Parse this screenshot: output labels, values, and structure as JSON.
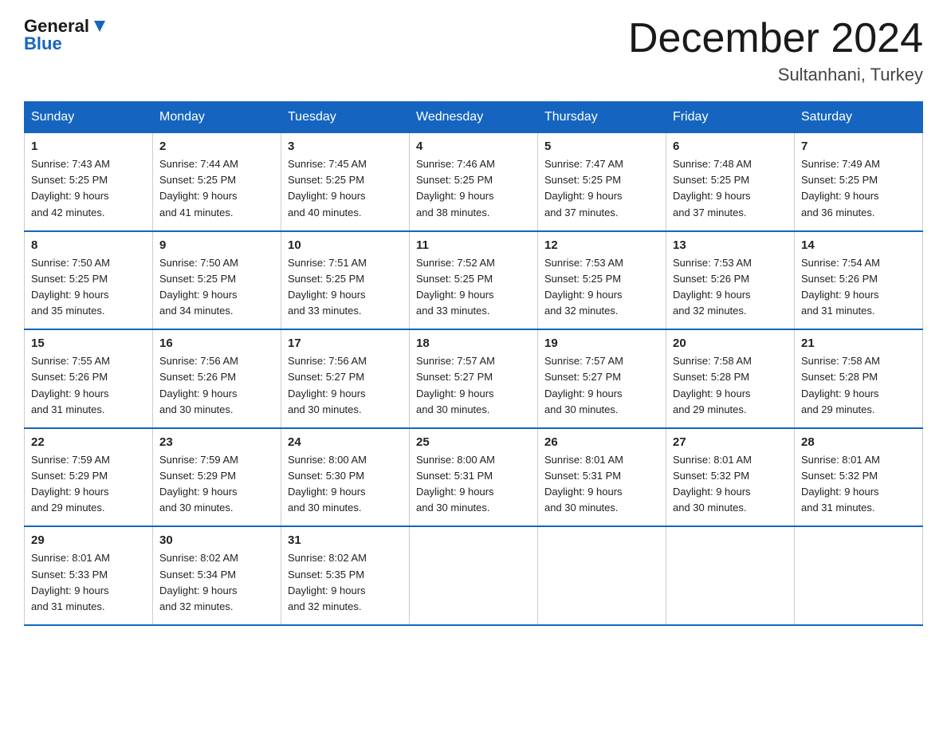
{
  "header": {
    "logo_general": "General",
    "logo_blue": "Blue",
    "title": "December 2024",
    "subtitle": "Sultanhani, Turkey"
  },
  "weekdays": [
    "Sunday",
    "Monday",
    "Tuesday",
    "Wednesday",
    "Thursday",
    "Friday",
    "Saturday"
  ],
  "weeks": [
    [
      {
        "day": "1",
        "sunrise": "7:43 AM",
        "sunset": "5:25 PM",
        "daylight": "9 hours and 42 minutes."
      },
      {
        "day": "2",
        "sunrise": "7:44 AM",
        "sunset": "5:25 PM",
        "daylight": "9 hours and 41 minutes."
      },
      {
        "day": "3",
        "sunrise": "7:45 AM",
        "sunset": "5:25 PM",
        "daylight": "9 hours and 40 minutes."
      },
      {
        "day": "4",
        "sunrise": "7:46 AM",
        "sunset": "5:25 PM",
        "daylight": "9 hours and 38 minutes."
      },
      {
        "day": "5",
        "sunrise": "7:47 AM",
        "sunset": "5:25 PM",
        "daylight": "9 hours and 37 minutes."
      },
      {
        "day": "6",
        "sunrise": "7:48 AM",
        "sunset": "5:25 PM",
        "daylight": "9 hours and 37 minutes."
      },
      {
        "day": "7",
        "sunrise": "7:49 AM",
        "sunset": "5:25 PM",
        "daylight": "9 hours and 36 minutes."
      }
    ],
    [
      {
        "day": "8",
        "sunrise": "7:50 AM",
        "sunset": "5:25 PM",
        "daylight": "9 hours and 35 minutes."
      },
      {
        "day": "9",
        "sunrise": "7:50 AM",
        "sunset": "5:25 PM",
        "daylight": "9 hours and 34 minutes."
      },
      {
        "day": "10",
        "sunrise": "7:51 AM",
        "sunset": "5:25 PM",
        "daylight": "9 hours and 33 minutes."
      },
      {
        "day": "11",
        "sunrise": "7:52 AM",
        "sunset": "5:25 PM",
        "daylight": "9 hours and 33 minutes."
      },
      {
        "day": "12",
        "sunrise": "7:53 AM",
        "sunset": "5:25 PM",
        "daylight": "9 hours and 32 minutes."
      },
      {
        "day": "13",
        "sunrise": "7:53 AM",
        "sunset": "5:26 PM",
        "daylight": "9 hours and 32 minutes."
      },
      {
        "day": "14",
        "sunrise": "7:54 AM",
        "sunset": "5:26 PM",
        "daylight": "9 hours and 31 minutes."
      }
    ],
    [
      {
        "day": "15",
        "sunrise": "7:55 AM",
        "sunset": "5:26 PM",
        "daylight": "9 hours and 31 minutes."
      },
      {
        "day": "16",
        "sunrise": "7:56 AM",
        "sunset": "5:26 PM",
        "daylight": "9 hours and 30 minutes."
      },
      {
        "day": "17",
        "sunrise": "7:56 AM",
        "sunset": "5:27 PM",
        "daylight": "9 hours and 30 minutes."
      },
      {
        "day": "18",
        "sunrise": "7:57 AM",
        "sunset": "5:27 PM",
        "daylight": "9 hours and 30 minutes."
      },
      {
        "day": "19",
        "sunrise": "7:57 AM",
        "sunset": "5:27 PM",
        "daylight": "9 hours and 30 minutes."
      },
      {
        "day": "20",
        "sunrise": "7:58 AM",
        "sunset": "5:28 PM",
        "daylight": "9 hours and 29 minutes."
      },
      {
        "day": "21",
        "sunrise": "7:58 AM",
        "sunset": "5:28 PM",
        "daylight": "9 hours and 29 minutes."
      }
    ],
    [
      {
        "day": "22",
        "sunrise": "7:59 AM",
        "sunset": "5:29 PM",
        "daylight": "9 hours and 29 minutes."
      },
      {
        "day": "23",
        "sunrise": "7:59 AM",
        "sunset": "5:29 PM",
        "daylight": "9 hours and 30 minutes."
      },
      {
        "day": "24",
        "sunrise": "8:00 AM",
        "sunset": "5:30 PM",
        "daylight": "9 hours and 30 minutes."
      },
      {
        "day": "25",
        "sunrise": "8:00 AM",
        "sunset": "5:31 PM",
        "daylight": "9 hours and 30 minutes."
      },
      {
        "day": "26",
        "sunrise": "8:01 AM",
        "sunset": "5:31 PM",
        "daylight": "9 hours and 30 minutes."
      },
      {
        "day": "27",
        "sunrise": "8:01 AM",
        "sunset": "5:32 PM",
        "daylight": "9 hours and 30 minutes."
      },
      {
        "day": "28",
        "sunrise": "8:01 AM",
        "sunset": "5:32 PM",
        "daylight": "9 hours and 31 minutes."
      }
    ],
    [
      {
        "day": "29",
        "sunrise": "8:01 AM",
        "sunset": "5:33 PM",
        "daylight": "9 hours and 31 minutes."
      },
      {
        "day": "30",
        "sunrise": "8:02 AM",
        "sunset": "5:34 PM",
        "daylight": "9 hours and 32 minutes."
      },
      {
        "day": "31",
        "sunrise": "8:02 AM",
        "sunset": "5:35 PM",
        "daylight": "9 hours and 32 minutes."
      },
      null,
      null,
      null,
      null
    ]
  ],
  "labels": {
    "sunrise": "Sunrise:",
    "sunset": "Sunset:",
    "daylight": "Daylight:"
  }
}
